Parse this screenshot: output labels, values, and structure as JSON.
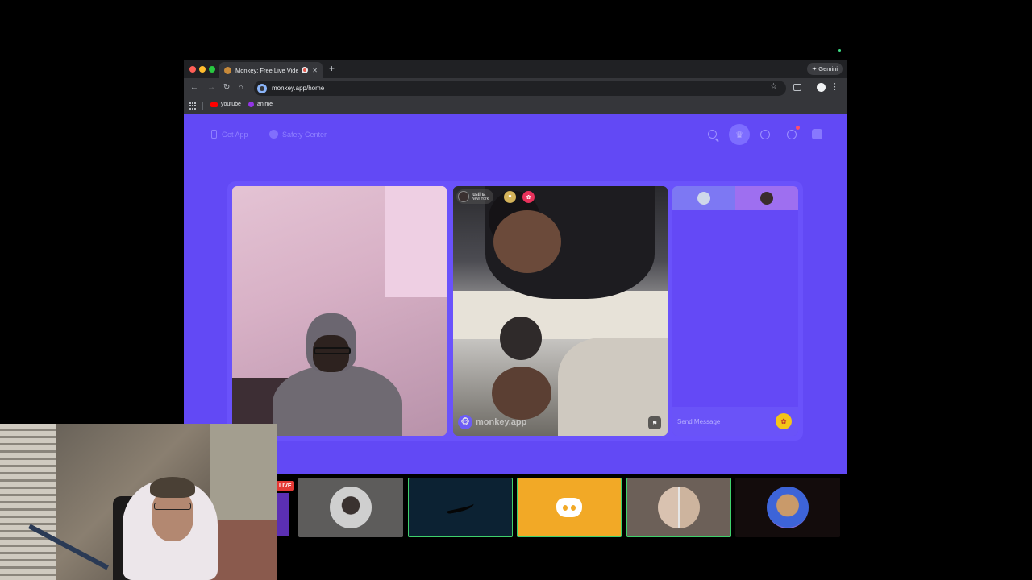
{
  "browser": {
    "tab": {
      "title": "Monkey: Free Live Video",
      "close_glyph": "✕"
    },
    "new_tab_glyph": "+",
    "gemini_label": "✦ Gemini",
    "url": "monkey.app/home",
    "nav": {
      "back": "←",
      "forward": "→",
      "reload": "↻",
      "home": "⌂"
    },
    "star_glyph": "☆",
    "menu_glyph": "⋮",
    "bookmarks": [
      {
        "label": "youtube",
        "icon": "youtube-icon"
      },
      {
        "label": "anime",
        "icon": "folder-icon"
      }
    ]
  },
  "monkey": {
    "header": {
      "get_app": "Get App",
      "safety_center": "Safety Center",
      "crown_glyph": "♛"
    },
    "remote_user": {
      "name": "justina",
      "location": "New York",
      "heart_glyph": "♥",
      "gift_glyph": "✿"
    },
    "watermark": "monkey.app",
    "watermark_logo": "🐵",
    "report_glyph": "⚑",
    "chat": {
      "send_placeholder": "Send Message",
      "gift_glyph": "✿"
    },
    "colors": {
      "page_bg": "#6249f5",
      "panel_bg": "#6a52fb",
      "chat_bg": "#6449f6"
    }
  },
  "stream_overlay": {
    "live_badge": "LIVE",
    "tiles": [
      {
        "name": "profile-avatar-tile",
        "icon": "avatar-icon"
      },
      {
        "name": "nike-tile",
        "icon": "nike-logo-icon"
      },
      {
        "name": "discord-tile",
        "icon": "discord-logo-icon"
      },
      {
        "name": "twins-avatar-tile",
        "icon": "avatar-icon"
      },
      {
        "name": "monkey-avatar-tile",
        "icon": "avatar-icon"
      }
    ],
    "colors": {
      "tile_border_active": "#3fd16c",
      "discord_bg": "#f2a926",
      "live_red": "#e53935"
    }
  }
}
